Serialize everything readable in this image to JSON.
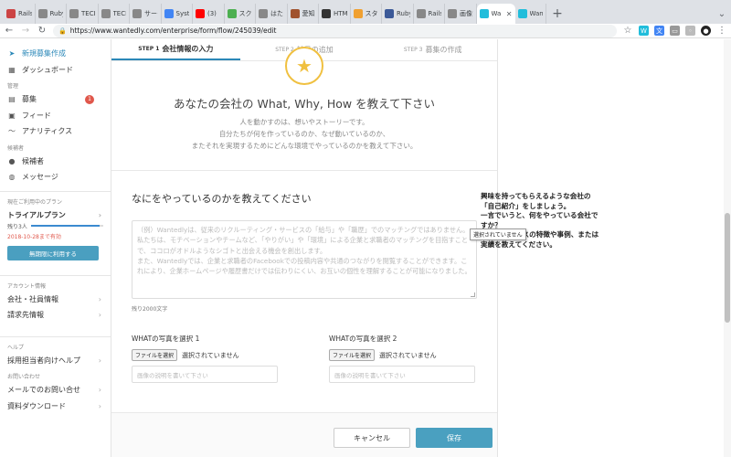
{
  "browser": {
    "tabs": [
      {
        "title": "Rails",
        "color": "#cc4444"
      },
      {
        "title": "Ruby o",
        "color": "#888888"
      },
      {
        "title": "TECH",
        "color": "#888888"
      },
      {
        "title": "TECH",
        "color": "#888888"
      },
      {
        "title": "サーク",
        "color": "#888888"
      },
      {
        "title": "Systen",
        "color": "#4285f4"
      },
      {
        "title": "(3)",
        "color": "#ff0000"
      },
      {
        "title": "スクロ",
        "color": "#4caf50"
      },
      {
        "title": "はたら",
        "color": "#888888"
      },
      {
        "title": "愛知県",
        "color": "#a0522d"
      },
      {
        "title": "HTML",
        "color": "#333333"
      },
      {
        "title": "スタイ",
        "color": "#f0a030"
      },
      {
        "title": "Ruby o",
        "color": "#3b5998"
      },
      {
        "title": "Rails",
        "color": "#888888"
      },
      {
        "title": "画像ア",
        "color": "#888888"
      },
      {
        "title": "Wa",
        "color": "#21bddb",
        "active": true
      },
      {
        "title": "Want",
        "color": "#21bddb"
      }
    ],
    "new_tab": "+",
    "window_menu": "⌄",
    "url": "https://www.wantedly.com/enterprise/form/flow/245039/edit"
  },
  "sidebar": {
    "create": "新規募集作成",
    "dashboard": "ダッシュボード",
    "manage_heading": "管理",
    "jobs": "募集",
    "jobs_badge": "1",
    "feed": "フィード",
    "analytics": "アナリティクス",
    "candidates_heading": "候補者",
    "candidates": "候補者",
    "messages": "メッセージ",
    "plan_heading": "現在ご利用中のプラン",
    "plan_name": "トライアルプラン",
    "plan_remaining_label": "残り3人",
    "plan_progress": 0.95,
    "plan_expire": "2018-10-28まで有効",
    "free_button": "無期限に利用する",
    "account_heading": "アカウント情報",
    "company_info": "会社・社員情報",
    "billing_info": "請求先情報",
    "help_heading": "ヘルプ",
    "recruiter_help": "採用担当者向けヘルプ",
    "contact_heading": "お問い合わせ",
    "mail_contact": "メールでのお問い合せ",
    "download": "資料ダウンロード"
  },
  "steps": [
    {
      "num": "STEP 1",
      "name": "会社情報の入力",
      "active": true
    },
    {
      "num": "STEP 2",
      "name": "社員の追加",
      "active": false
    },
    {
      "num": "STEP 3",
      "name": "募集の作成",
      "active": false
    }
  ],
  "intro": {
    "title": "あなたの会社の What, Why, How を教えて下さい",
    "lines": [
      "人を動かすのは、想いやストーリーです。",
      "自分たちが何を作っているのか、なぜ動いているのか、",
      "またそれを実現するためにどんな環境でやっているのかを教えて下さい。"
    ]
  },
  "what_section": {
    "title": "なにをやっているのかを教えてください",
    "placeholder_lines": [
      "（例）Wantedlyは、従来のリクルーティング・サービスの「給与」や「職歴」でのマッチングではありません。私たちは、モチベーションやチームなど、「やりがい」や「環境」による企業と求職者のマッチングを目指すことで、ココロがオドルようなシゴトと出会える機会を創出します。",
      "また、Wantedlyでは、企業と求職者のFacebookでの投稿内容や共通のつながりを閲覧することができます。これにより、企業ホームページや履歴書だけでは伝わりにくい、お互いの個性を理解することが可能になりました。"
    ],
    "remaining": "残り2000文字",
    "photo1_label": "WHATの写真を選択 1",
    "photo2_label": "WHATの写真を選択 2",
    "file_button": "ファイルを選択",
    "no_file": "選択されていません",
    "caption_placeholder": "画像の説明を書いて下さい"
  },
  "footer": {
    "cancel": "キャンセル",
    "save": "保存"
  },
  "help_panel": {
    "text": "興味を持ってもらえるような会社の「自己紹介」をしましょう。\n一言でいうと、何をやっている会社ですか？\n事業やサービスの特徴や事例、または実績を教えてください。"
  },
  "tooltip": "選択されていません",
  "colors": {
    "brand": "#21bddb",
    "primary_blue": "#2b88b8",
    "save_button": "#4aa0c0",
    "badge_red": "#e0574b"
  }
}
